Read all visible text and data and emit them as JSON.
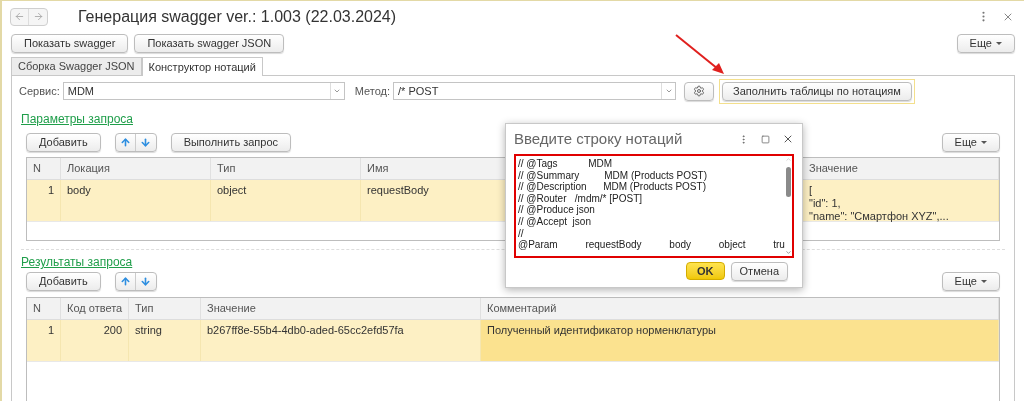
{
  "window": {
    "title": "Генерация swagger ver.: 1.003 (22.03.2024)"
  },
  "top_buttons": [
    "Показать swagger",
    "Показать swagger JSON"
  ],
  "more_button": "Еще",
  "tabs": [
    {
      "label": "Сборка Swagger JSON",
      "selected": false
    },
    {
      "label": "Конструктор нотаций",
      "selected": true
    }
  ],
  "service": {
    "label": "Сервис:",
    "value": "MDM"
  },
  "method": {
    "label": "Метод:",
    "value": "/* POST"
  },
  "fill_button": "Заполнить таблицы по нотациям",
  "params": {
    "title": "Параметры запроса",
    "buttons": [
      "Добавить",
      "Выполнить запрос"
    ],
    "more": "Еще",
    "columns": [
      "N",
      "Локация",
      "Тип",
      "Имя",
      "Значение"
    ],
    "rows": [
      {
        "selected": true,
        "cells": [
          "1",
          "body",
          "object",
          "requestBody",
          "[\n\"id\": 1,\n\"name\": \"Смартфон XYZ\",..."
        ]
      }
    ]
  },
  "results": {
    "title": "Результаты запроса",
    "buttons": [
      "Добавить"
    ],
    "more": "Еще",
    "columns": [
      "N",
      "Код ответа",
      "Тип",
      "Значение",
      "Комментарий"
    ],
    "rows": [
      {
        "selected": true,
        "highlighted_cells": [
          false,
          false,
          false,
          false,
          true
        ],
        "cells": [
          "1",
          "200",
          "string",
          "b267ff8e-55b4-4db0-aded-65cc2efd57fa",
          "Полученный идентификатор норменклатуры"
        ]
      }
    ]
  },
  "dialog": {
    "title": "Введите строку нотаций",
    "lines": [
      "// @Tags           MDM",
      "// @Summary         MDM (Products POST)",
      "// @Description      MDM (Products POST)",
      "// @Router   /mdm/* [POST]",
      "// @Produce json",
      "// @Accept  json",
      "//",
      "@Param          requestBody          body          object          tru"
    ],
    "ok": "OK",
    "cancel": "Отмена"
  }
}
